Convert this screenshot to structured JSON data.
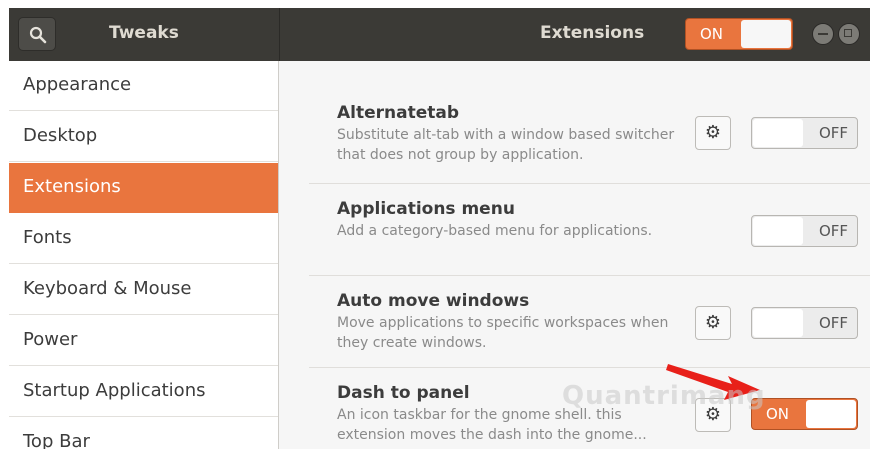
{
  "header": {
    "app_title": "Tweaks",
    "page_title": "Extensions",
    "master_switch": "ON"
  },
  "sidebar": {
    "items": [
      {
        "label": "Appearance"
      },
      {
        "label": "Desktop"
      },
      {
        "label": "Extensions",
        "active": true
      },
      {
        "label": "Fonts"
      },
      {
        "label": "Keyboard & Mouse"
      },
      {
        "label": "Power"
      },
      {
        "label": "Startup Applications"
      },
      {
        "label": "Top Bar"
      }
    ]
  },
  "extensions": [
    {
      "name": "Alternatetab",
      "desc": "Substitute alt-tab with a window based switcher that does not group by application.",
      "state": "OFF",
      "has_settings": true
    },
    {
      "name": "Applications menu",
      "desc": "Add a category-based menu for applications.",
      "state": "OFF",
      "has_settings": false
    },
    {
      "name": "Auto move windows",
      "desc": "Move applications to specific workspaces when they create windows.",
      "state": "OFF",
      "has_settings": true
    },
    {
      "name": "Dash to panel",
      "desc": "An icon taskbar for the gnome shell. this extension moves the dash into the gnome...",
      "state": "ON",
      "has_settings": true
    }
  ],
  "watermark": "Quantrimang",
  "colors": {
    "accent": "#e9753e",
    "header": "#3b3a36",
    "pointer": "#e8201a"
  }
}
